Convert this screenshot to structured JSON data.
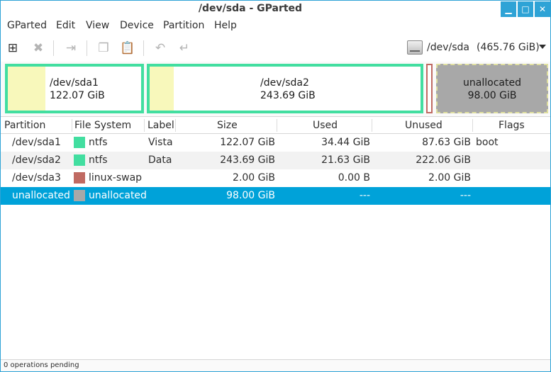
{
  "window": {
    "title": "/dev/sda - GParted",
    "controls": {
      "minimize": "▁",
      "maximize": "□",
      "close": "✕"
    }
  },
  "menubar": {
    "items": [
      "GParted",
      "Edit",
      "View",
      "Device",
      "Partition",
      "Help"
    ]
  },
  "toolbar": {
    "icons": [
      {
        "name": "new-partition-icon",
        "glyph": "⊞",
        "enabled": true
      },
      {
        "name": "delete-icon",
        "glyph": "✖",
        "enabled": false
      },
      {
        "name": "resize-move-icon",
        "glyph": "⇥",
        "enabled": false
      },
      {
        "name": "copy-icon",
        "glyph": "❐",
        "enabled": false
      },
      {
        "name": "paste-icon",
        "glyph": "📋",
        "enabled": false
      },
      {
        "name": "undo-icon",
        "glyph": "↶",
        "enabled": false
      },
      {
        "name": "apply-icon",
        "glyph": "↵",
        "enabled": false
      }
    ],
    "device": {
      "name": "/dev/sda",
      "size": "(465.76 GiB)"
    }
  },
  "diskmap": {
    "partitions": [
      {
        "name": "/dev/sda1",
        "size": "122.07 GiB",
        "used_fraction": 0.28
      },
      {
        "name": "/dev/sda2",
        "size": "243.69 GiB",
        "used_fraction": 0.09
      }
    ],
    "unallocated": {
      "name": "unallocated",
      "size": "98.00 GiB"
    }
  },
  "table": {
    "columns": [
      "Partition",
      "File System",
      "Label",
      "Size",
      "Used",
      "Unused",
      "Flags"
    ],
    "rows": [
      {
        "partition": "/dev/sda1",
        "fs": "ntfs",
        "fs_color": "#42dea0",
        "label": "Vista",
        "size": "122.07 GiB",
        "used": "34.44 GiB",
        "unused": "87.63 GiB",
        "flags": "boot"
      },
      {
        "partition": "/dev/sda2",
        "fs": "ntfs",
        "fs_color": "#42dea0",
        "label": "Data",
        "size": "243.69 GiB",
        "used": "21.63 GiB",
        "unused": "222.06 GiB",
        "flags": ""
      },
      {
        "partition": "/dev/sda3",
        "fs": "linux-swap",
        "fs_color": "#c06a62",
        "label": "",
        "size": "2.00 GiB",
        "used": "0.00 B",
        "unused": "2.00 GiB",
        "flags": ""
      },
      {
        "partition": "unallocated",
        "fs": "unallocated",
        "fs_color": "#a8a8a8",
        "label": "",
        "size": "98.00 GiB",
        "used": "---",
        "unused": "---",
        "flags": ""
      }
    ]
  },
  "status": {
    "text": "0 operations pending"
  },
  "colors": {
    "accent": "#00a2d9",
    "ntfs": "#42dea0",
    "swap": "#c06a62",
    "unallocated": "#a8a8a8"
  }
}
